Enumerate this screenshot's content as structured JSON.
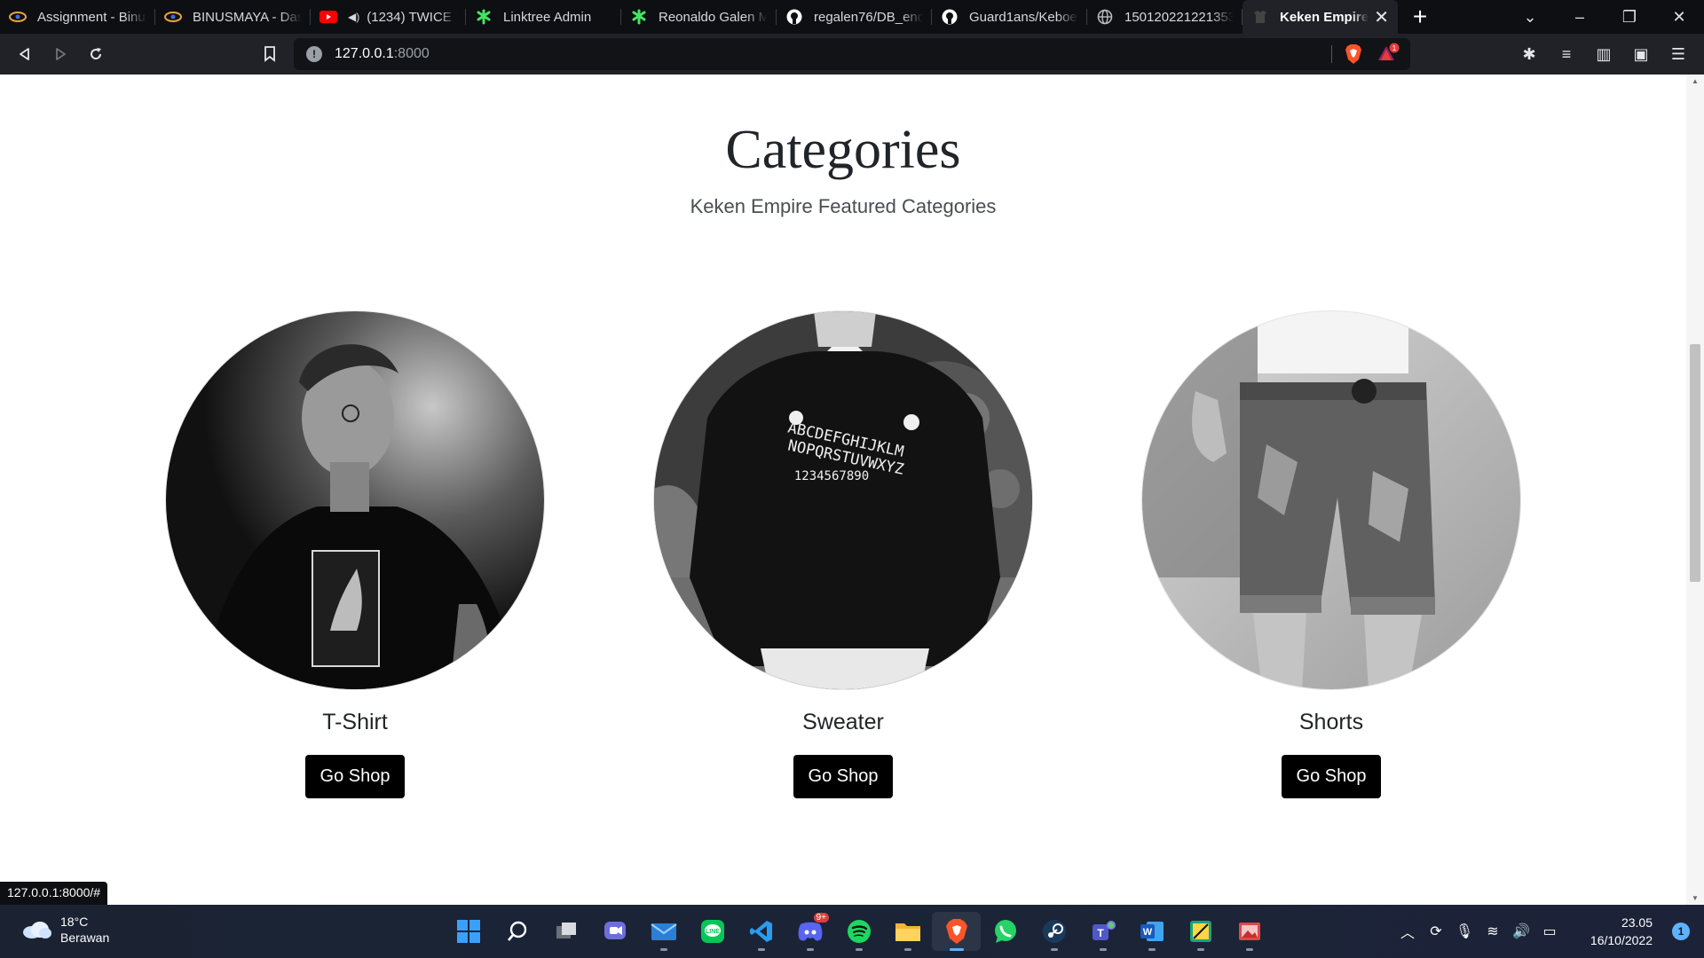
{
  "tabs": [
    {
      "title": "Assignment - Binus",
      "icon": "binus-icon"
    },
    {
      "title": "BINUSMAYA - Dash",
      "icon": "binus-icon"
    },
    {
      "title": "(1234) TWICE \"V",
      "icon": "youtube-icon"
    },
    {
      "title": "Linktree Admin",
      "icon": "linktree-icon"
    },
    {
      "title": "Reonaldo Galen Ma",
      "icon": "linktree-icon"
    },
    {
      "title": "regalen76/DB_end_",
      "icon": "github-icon"
    },
    {
      "title": "Guard1ans/Keboen",
      "icon": "github-icon"
    },
    {
      "title": "1501202212213535",
      "icon": "globe-icon"
    },
    {
      "title": "Keken Empire",
      "icon": "site-icon"
    }
  ],
  "address": {
    "host": "127.0.0.1",
    "port": ":8000"
  },
  "page": {
    "title": "Categories",
    "subtitle": "Keken Empire Featured Categories",
    "categories": [
      {
        "name": "T-Shirt",
        "button": "Go Shop"
      },
      {
        "name": "Sweater",
        "button": "Go Shop"
      },
      {
        "name": "Shorts",
        "button": "Go Shop"
      }
    ]
  },
  "status_url": "127.0.0.1:8000/#",
  "taskbar": {
    "temperature": "18°C",
    "condition": "Berawan",
    "time": "23.05",
    "date": "16/10/2022",
    "notifications": "1",
    "discord_badge": "9+"
  },
  "colors": {
    "accent": "#000000",
    "tab_bg": "#0d0f12",
    "toolbar_bg": "#202227"
  }
}
